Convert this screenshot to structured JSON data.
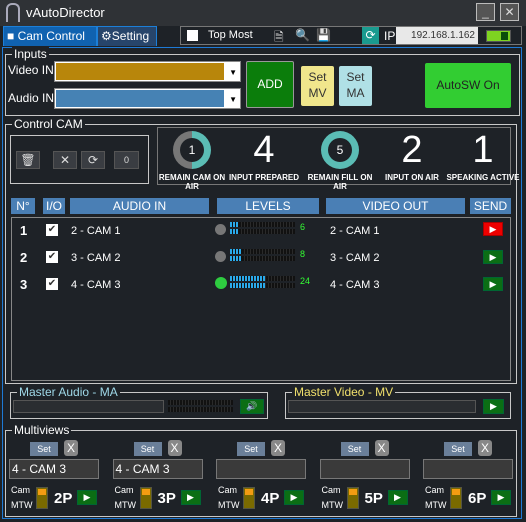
{
  "window": {
    "title": "vAutoDirector",
    "minimize": "_",
    "close": "✕"
  },
  "tabs": [
    {
      "label": "Cam Control",
      "icon": "camera-icon"
    },
    {
      "label": "Setting",
      "icon": "gear-icon"
    }
  ],
  "toolbar": {
    "top_most": "Top Most",
    "top_most_checked": false,
    "ip_label": "IP",
    "ip_value": "192.168.1.162",
    "toggle_on": true
  },
  "inputs": {
    "title": "Inputs",
    "video_in_label": "Video IN",
    "audio_in_label": "Audio IN",
    "video_color": "#b8860b",
    "audio_color": "#4682b4",
    "add": "ADD",
    "set_mv": "Set MV",
    "set_ma": "Set MA",
    "autosw": "AutoSW On"
  },
  "control": {
    "title": "Control CAM",
    "counter_value": "0",
    "stats": [
      {
        "value": "1",
        "label": "REMAIN CAM ON AIR",
        "ring": true,
        "ring_fraction": 0.5
      },
      {
        "value": "4",
        "label": "INPUT PREPARED"
      },
      {
        "value": "5",
        "label": "REMAIN FILL ON AIR",
        "ring": true,
        "ring_fraction": 1
      },
      {
        "value": "2",
        "label": "INPUT ON AIR"
      },
      {
        "value": "1",
        "label": "SPEAKING ACTIVE"
      }
    ],
    "headers": {
      "n": "N°",
      "io": "I/O",
      "audio_in": "AUDIO IN",
      "levels": "LEVELS",
      "video_out": "VIDEO OUT",
      "send": "SEND"
    },
    "rows": [
      {
        "n": "1",
        "checked": true,
        "audio_in": "2 - CAM 1",
        "level": "6",
        "active": false,
        "video_out": "2 - CAM 1",
        "send_state": "live"
      },
      {
        "n": "2",
        "checked": true,
        "audio_in": "3 - CAM 2",
        "level": "8",
        "active": false,
        "video_out": "3 - CAM 2",
        "send_state": "ready"
      },
      {
        "n": "3",
        "checked": true,
        "audio_in": "4 - CAM 3",
        "level": "24",
        "active": true,
        "video_out": "4 - CAM 3",
        "send_state": "ready"
      }
    ]
  },
  "master": {
    "audio_title": "Master Audio - MA",
    "video_title": "Master Video - MV"
  },
  "multiviews": {
    "title": "Multiviews",
    "set": "Set",
    "x": "X",
    "cam": "Cam",
    "mtw": "MTW",
    "items": [
      {
        "value": "4 - CAM 3",
        "label": "2P"
      },
      {
        "value": "4 - CAM 3",
        "label": "3P"
      },
      {
        "value": "",
        "label": "4P"
      },
      {
        "value": "",
        "label": "5P"
      },
      {
        "value": "",
        "label": "6P"
      }
    ]
  }
}
